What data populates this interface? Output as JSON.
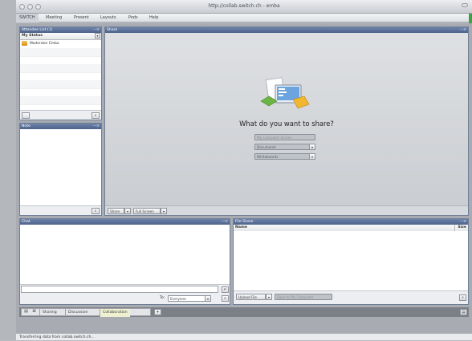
{
  "window": {
    "title": "http://collab.switch.ch - emba"
  },
  "menu": [
    {
      "label": "SWITCH"
    },
    {
      "label": "Meeting"
    },
    {
      "label": "Present"
    },
    {
      "label": "Layouts"
    },
    {
      "label": "Pods"
    },
    {
      "label": "Help"
    }
  ],
  "attendees": {
    "title": "Attendee List (1)",
    "controls": "—≡",
    "status_label": "My Status",
    "status_dropdown": "▾",
    "users": [
      {
        "name": "Moderator Emba"
      }
    ]
  },
  "share": {
    "title": "Share",
    "controls": "—≡",
    "prompt": "What do you want to share?",
    "option_computer": "My Computer Screen",
    "option_documents": "Documents",
    "option_whiteboards": "Whiteboards",
    "share_button": "Share",
    "fullscreen_button": "Full Screen"
  },
  "note": {
    "title": "Note",
    "controls": "—≡"
  },
  "chat": {
    "title": "Chat",
    "controls": "—≡",
    "to_label": "To:",
    "to_value": "Everyone",
    "send_icon": "send-icon"
  },
  "files": {
    "title": "File Share",
    "controls": "—≡",
    "col_name": "Name",
    "col_size": "Size",
    "upload_button": "Upload File",
    "save_button": "Save to My Computer"
  },
  "tabs": [
    {
      "label": "Sharing"
    },
    {
      "label": "Discussion"
    },
    {
      "label": "Collaboration"
    }
  ],
  "add_tab": "+",
  "status": {
    "text": "Transferring data from collab.switch.ch..."
  },
  "colors": {
    "pod_header": "#5a6f97",
    "selected_tab": "#eef0cf",
    "accent_green": "#3aa34a"
  }
}
